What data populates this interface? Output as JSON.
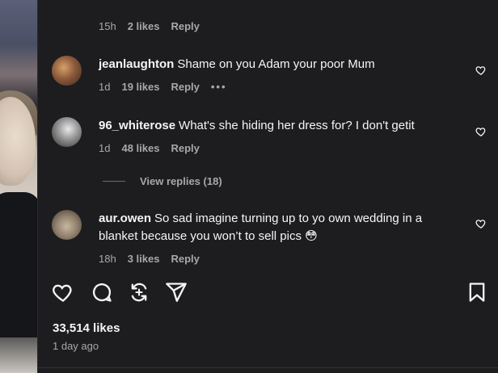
{
  "top_comment": {
    "time": "15h",
    "likes": "2 likes",
    "reply": "Reply"
  },
  "comments": [
    {
      "username": "jeanlaughton",
      "text": "Shame on you Adam your poor Mum",
      "time": "1d",
      "likes": "19 likes",
      "reply": "Reply",
      "more": "•••"
    },
    {
      "username": "96_whiterose",
      "text": "What's she hiding her dress for? I don't getit",
      "time": "1d",
      "likes": "48 likes",
      "reply": "Reply"
    },
    {
      "username": "aur.owen",
      "text": "So sad imagine turning up to yo own wedding in a blanket because you won’t to sell pics",
      "emoji": "😳",
      "time": "18h",
      "likes": "3 likes",
      "reply": "Reply"
    }
  ],
  "view_replies": "View replies (18)",
  "post": {
    "likes": "33,514 likes",
    "posted": "1 day ago"
  },
  "icons": [
    "heart-icon",
    "comment-icon",
    "repost-icon",
    "share-icon",
    "save-icon"
  ]
}
